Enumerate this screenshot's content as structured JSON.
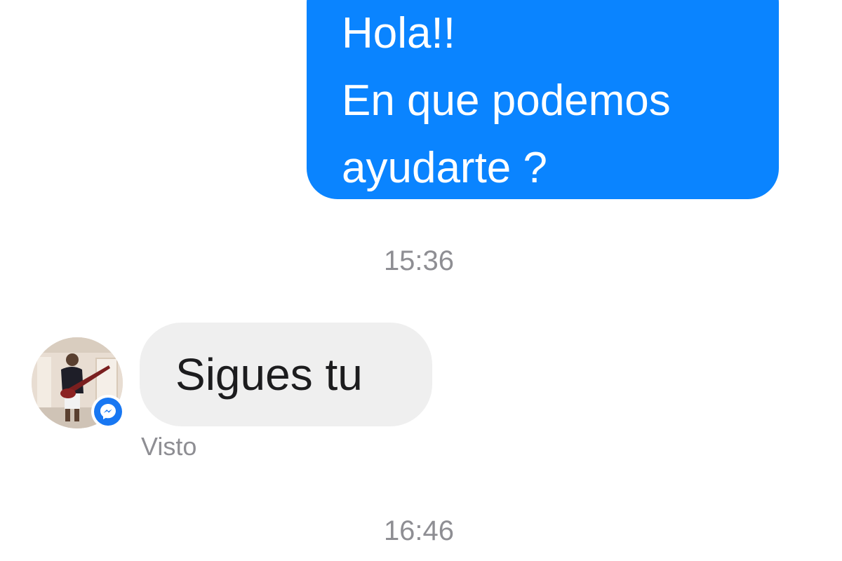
{
  "conversation": {
    "outgoing_message": {
      "lines": [
        "Hola!!",
        "En que podemos",
        "ayudarte ?"
      ]
    },
    "timestamps": [
      "15:36",
      "16:46"
    ],
    "incoming_message": {
      "text": "Sigues tu",
      "status": "Visto"
    },
    "avatar_badge_icon": "messenger-icon"
  },
  "colors": {
    "outgoing_bubble": "#0a84ff",
    "incoming_bubble": "#efefef",
    "timestamp_text": "#8e8e93",
    "messenger_badge": "#1877f2"
  }
}
